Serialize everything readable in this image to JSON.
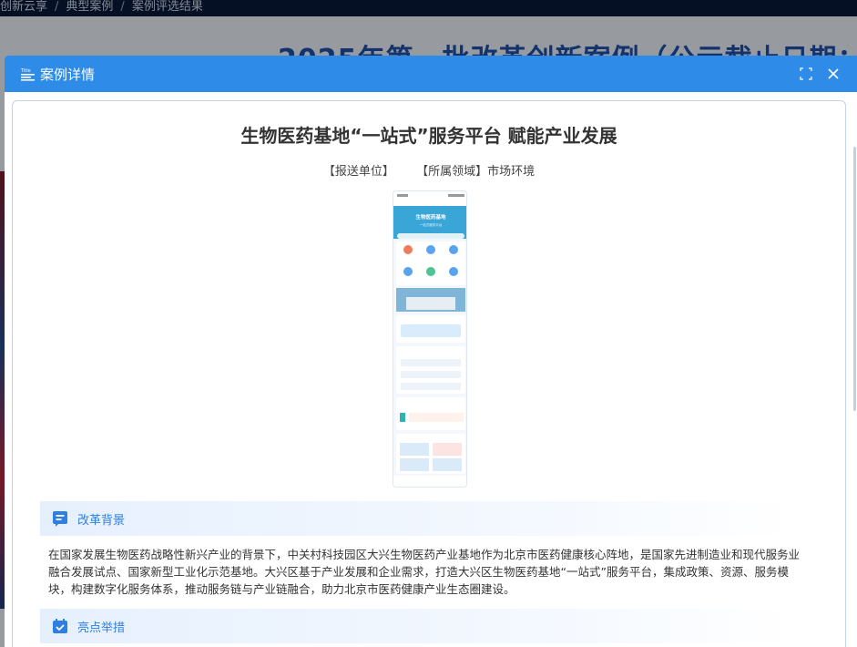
{
  "background": {
    "breadcrumb": [
      "创新云享",
      "典型案例",
      "案例评选结果"
    ],
    "banner_title": "2025年第一批改革创新案例（公示截止日期：",
    "colors": {
      "topbar": "#0a1a3a",
      "banner": "#1f4fa8"
    }
  },
  "modal": {
    "title": "案例详情",
    "header_color": "#2f8be8",
    "case": {
      "title": "生物医药基地“一站式”服务平台 赋能产业发展",
      "unit_label": "【报送单位】",
      "field_label": "【所属领域】市场环境"
    },
    "phone_screenshot": {
      "banner_text": "生物医药基地",
      "banner_sub": "一站式服务平台",
      "icon_name": "app-screenshot"
    },
    "sections": [
      {
        "label": "改革背景",
        "icon": "flag-icon"
      },
      {
        "label": "亮点举措",
        "icon": "calendar-check-icon"
      }
    ],
    "background_text": "在国家发展生物医药战略性新兴产业的背景下，中关村科技园区大兴生物医药产业基地作为北京市医药健康核心阵地，是国家先进制造业和现代服务业融合发展试点、国家新型工业化示范基地。大兴区基于产业发展和企业需求，打造大兴区生物医药基地“一站式”服务平台，集成政策、资源、服务模块，构建数字化服务体系，推动服务链与产业链融合，助力北京市医药健康产业生态圈建设。"
  }
}
